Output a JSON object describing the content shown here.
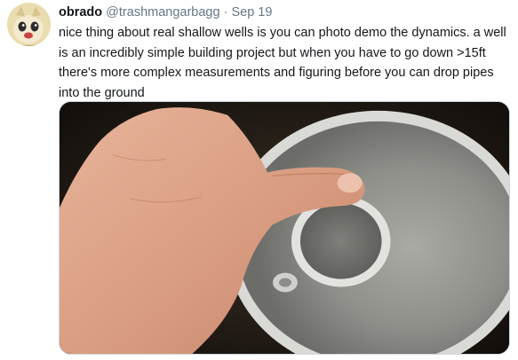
{
  "tweet": {
    "author_name": "obrado",
    "author_handle": "@trashmangarbagg",
    "separator": "·",
    "date": "Sep 19",
    "text": "nice thing about real shallow wells is you can photo demo the dynamics. a well is an incredibly simple building project but when you have to go down >15ft there's more complex measurements and figuring before you can drop pipes into the ground",
    "avatar_icon": "cartoon-avatar-icon",
    "media_icon": "pipe-photo-image"
  },
  "colors": {
    "text": "#14171a",
    "secondary_text": "#657786",
    "border": "#ccd6dd"
  }
}
